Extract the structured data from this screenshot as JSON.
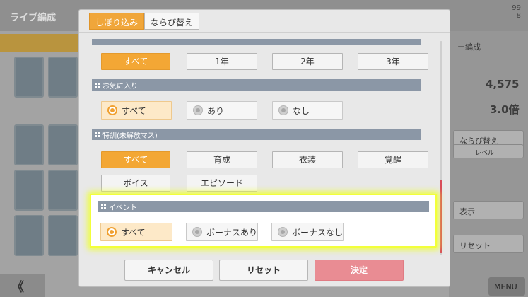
{
  "background": {
    "title": "ライブ編成",
    "right_panel": {
      "lbl1": "ー編成",
      "value1": "4,575",
      "value2": "3.0倍",
      "sort": "ならび替え",
      "level": "レベル",
      "show": "表示",
      "reset": "リセット"
    },
    "back": "《",
    "menu": "MENU",
    "counter": "99",
    "counter2": "8"
  },
  "modal": {
    "tabs": [
      "しぼり込み",
      "ならび替え"
    ],
    "grade_buttons": [
      "すべて",
      "1年",
      "2年",
      "3年"
    ],
    "favorites": {
      "header": "お気に入り",
      "options": [
        "すべて",
        "あり",
        "なし"
      ]
    },
    "training": {
      "header": "特訓(未解放マス)",
      "buttons": [
        "すべて",
        "育成",
        "衣装",
        "覚醒",
        "ボイス",
        "エピソード"
      ]
    },
    "event": {
      "header": "イベント",
      "options": [
        "すべて",
        "ボーナスあり",
        "ボーナスなし"
      ]
    },
    "footer": {
      "cancel": "キャンセル",
      "reset": "リセット",
      "confirm": "決定"
    }
  },
  "colors": {
    "accent": "#f3a735",
    "section_header": "#8b97a6",
    "confirm": "#e98c93",
    "highlight": "#f2ff3a"
  }
}
